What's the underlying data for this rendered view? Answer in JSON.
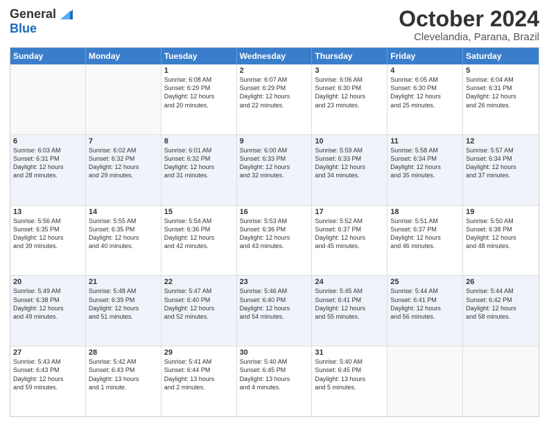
{
  "header": {
    "logo_line1": "General",
    "logo_line2": "Blue",
    "month_title": "October 2024",
    "location": "Clevelandia, Parana, Brazil"
  },
  "days_of_week": [
    "Sunday",
    "Monday",
    "Tuesday",
    "Wednesday",
    "Thursday",
    "Friday",
    "Saturday"
  ],
  "weeks": [
    [
      {
        "day": "",
        "lines": []
      },
      {
        "day": "",
        "lines": []
      },
      {
        "day": "1",
        "lines": [
          "Sunrise: 6:08 AM",
          "Sunset: 6:29 PM",
          "Daylight: 12 hours",
          "and 20 minutes."
        ]
      },
      {
        "day": "2",
        "lines": [
          "Sunrise: 6:07 AM",
          "Sunset: 6:29 PM",
          "Daylight: 12 hours",
          "and 22 minutes."
        ]
      },
      {
        "day": "3",
        "lines": [
          "Sunrise: 6:06 AM",
          "Sunset: 6:30 PM",
          "Daylight: 12 hours",
          "and 23 minutes."
        ]
      },
      {
        "day": "4",
        "lines": [
          "Sunrise: 6:05 AM",
          "Sunset: 6:30 PM",
          "Daylight: 12 hours",
          "and 25 minutes."
        ]
      },
      {
        "day": "5",
        "lines": [
          "Sunrise: 6:04 AM",
          "Sunset: 6:31 PM",
          "Daylight: 12 hours",
          "and 26 minutes."
        ]
      }
    ],
    [
      {
        "day": "6",
        "lines": [
          "Sunrise: 6:03 AM",
          "Sunset: 6:31 PM",
          "Daylight: 12 hours",
          "and 28 minutes."
        ]
      },
      {
        "day": "7",
        "lines": [
          "Sunrise: 6:02 AM",
          "Sunset: 6:32 PM",
          "Daylight: 12 hours",
          "and 29 minutes."
        ]
      },
      {
        "day": "8",
        "lines": [
          "Sunrise: 6:01 AM",
          "Sunset: 6:32 PM",
          "Daylight: 12 hours",
          "and 31 minutes."
        ]
      },
      {
        "day": "9",
        "lines": [
          "Sunrise: 6:00 AM",
          "Sunset: 6:33 PM",
          "Daylight: 12 hours",
          "and 32 minutes."
        ]
      },
      {
        "day": "10",
        "lines": [
          "Sunrise: 5:59 AM",
          "Sunset: 6:33 PM",
          "Daylight: 12 hours",
          "and 34 minutes."
        ]
      },
      {
        "day": "11",
        "lines": [
          "Sunrise: 5:58 AM",
          "Sunset: 6:34 PM",
          "Daylight: 12 hours",
          "and 35 minutes."
        ]
      },
      {
        "day": "12",
        "lines": [
          "Sunrise: 5:57 AM",
          "Sunset: 6:34 PM",
          "Daylight: 12 hours",
          "and 37 minutes."
        ]
      }
    ],
    [
      {
        "day": "13",
        "lines": [
          "Sunrise: 5:56 AM",
          "Sunset: 6:35 PM",
          "Daylight: 12 hours",
          "and 39 minutes."
        ]
      },
      {
        "day": "14",
        "lines": [
          "Sunrise: 5:55 AM",
          "Sunset: 6:35 PM",
          "Daylight: 12 hours",
          "and 40 minutes."
        ]
      },
      {
        "day": "15",
        "lines": [
          "Sunrise: 5:54 AM",
          "Sunset: 6:36 PM",
          "Daylight: 12 hours",
          "and 42 minutes."
        ]
      },
      {
        "day": "16",
        "lines": [
          "Sunrise: 5:53 AM",
          "Sunset: 6:36 PM",
          "Daylight: 12 hours",
          "and 43 minutes."
        ]
      },
      {
        "day": "17",
        "lines": [
          "Sunrise: 5:52 AM",
          "Sunset: 6:37 PM",
          "Daylight: 12 hours",
          "and 45 minutes."
        ]
      },
      {
        "day": "18",
        "lines": [
          "Sunrise: 5:51 AM",
          "Sunset: 6:37 PM",
          "Daylight: 12 hours",
          "and 46 minutes."
        ]
      },
      {
        "day": "19",
        "lines": [
          "Sunrise: 5:50 AM",
          "Sunset: 6:38 PM",
          "Daylight: 12 hours",
          "and 48 minutes."
        ]
      }
    ],
    [
      {
        "day": "20",
        "lines": [
          "Sunrise: 5:49 AM",
          "Sunset: 6:38 PM",
          "Daylight: 12 hours",
          "and 49 minutes."
        ]
      },
      {
        "day": "21",
        "lines": [
          "Sunrise: 5:48 AM",
          "Sunset: 6:39 PM",
          "Daylight: 12 hours",
          "and 51 minutes."
        ]
      },
      {
        "day": "22",
        "lines": [
          "Sunrise: 5:47 AM",
          "Sunset: 6:40 PM",
          "Daylight: 12 hours",
          "and 52 minutes."
        ]
      },
      {
        "day": "23",
        "lines": [
          "Sunrise: 5:46 AM",
          "Sunset: 6:40 PM",
          "Daylight: 12 hours",
          "and 54 minutes."
        ]
      },
      {
        "day": "24",
        "lines": [
          "Sunrise: 5:45 AM",
          "Sunset: 6:41 PM",
          "Daylight: 12 hours",
          "and 55 minutes."
        ]
      },
      {
        "day": "25",
        "lines": [
          "Sunrise: 5:44 AM",
          "Sunset: 6:41 PM",
          "Daylight: 12 hours",
          "and 56 minutes."
        ]
      },
      {
        "day": "26",
        "lines": [
          "Sunrise: 5:44 AM",
          "Sunset: 6:42 PM",
          "Daylight: 12 hours",
          "and 58 minutes."
        ]
      }
    ],
    [
      {
        "day": "27",
        "lines": [
          "Sunrise: 5:43 AM",
          "Sunset: 6:43 PM",
          "Daylight: 12 hours",
          "and 59 minutes."
        ]
      },
      {
        "day": "28",
        "lines": [
          "Sunrise: 5:42 AM",
          "Sunset: 6:43 PM",
          "Daylight: 13 hours",
          "and 1 minute."
        ]
      },
      {
        "day": "29",
        "lines": [
          "Sunrise: 5:41 AM",
          "Sunset: 6:44 PM",
          "Daylight: 13 hours",
          "and 2 minutes."
        ]
      },
      {
        "day": "30",
        "lines": [
          "Sunrise: 5:40 AM",
          "Sunset: 6:45 PM",
          "Daylight: 13 hours",
          "and 4 minutes."
        ]
      },
      {
        "day": "31",
        "lines": [
          "Sunrise: 5:40 AM",
          "Sunset: 6:45 PM",
          "Daylight: 13 hours",
          "and 5 minutes."
        ]
      },
      {
        "day": "",
        "lines": []
      },
      {
        "day": "",
        "lines": []
      }
    ]
  ]
}
